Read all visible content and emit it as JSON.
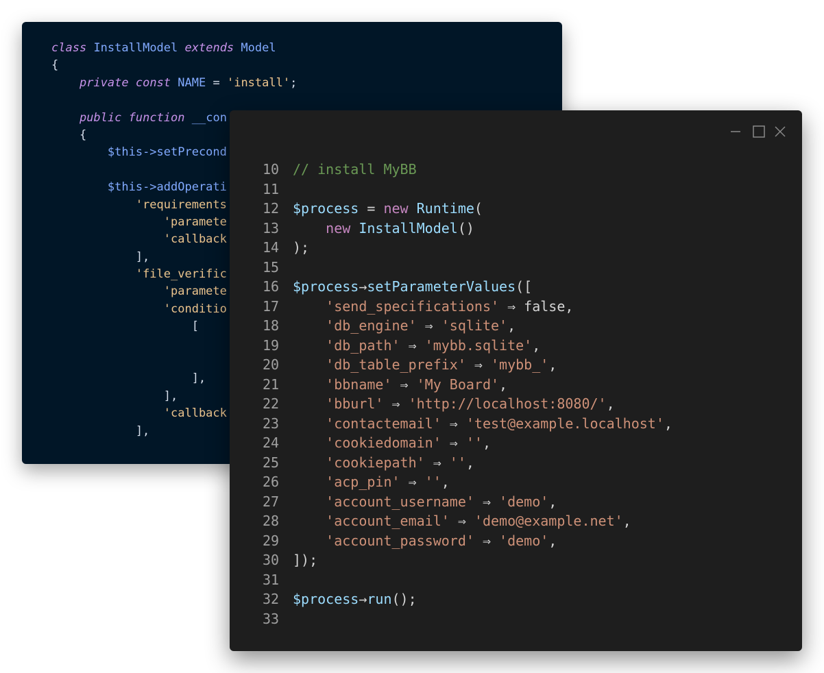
{
  "back_window": {
    "lines": [
      [
        {
          "t": "class",
          "c": "kw"
        },
        {
          "t": " "
        },
        {
          "t": "InstallModel",
          "c": "cls"
        },
        {
          "t": " "
        },
        {
          "t": "extends",
          "c": "kw"
        },
        {
          "t": " "
        },
        {
          "t": "Model",
          "c": "cls"
        }
      ],
      [
        {
          "t": "{"
        }
      ],
      [
        {
          "t": "    "
        },
        {
          "t": "private",
          "c": "kw"
        },
        {
          "t": " "
        },
        {
          "t": "const",
          "c": "kw"
        },
        {
          "t": " "
        },
        {
          "t": "NAME",
          "c": "cls"
        },
        {
          "t": " = "
        },
        {
          "t": "'install'",
          "c": "str"
        },
        {
          "t": ";"
        }
      ],
      [
        {
          "t": ""
        }
      ],
      [
        {
          "t": "    "
        },
        {
          "t": "public",
          "c": "kw"
        },
        {
          "t": " "
        },
        {
          "t": "function",
          "c": "kw"
        },
        {
          "t": " "
        },
        {
          "t": "__con",
          "c": "fn"
        }
      ],
      [
        {
          "t": "    {"
        }
      ],
      [
        {
          "t": "        "
        },
        {
          "t": "$this->setPrecond",
          "c": "var"
        }
      ],
      [
        {
          "t": ""
        }
      ],
      [
        {
          "t": "        "
        },
        {
          "t": "$this->addOperati",
          "c": "var"
        }
      ],
      [
        {
          "t": "            "
        },
        {
          "t": "'requirements",
          "c": "str"
        }
      ],
      [
        {
          "t": "                "
        },
        {
          "t": "'paramete",
          "c": "str"
        }
      ],
      [
        {
          "t": "                "
        },
        {
          "t": "'callback",
          "c": "str"
        }
      ],
      [
        {
          "t": "            ],"
        }
      ],
      [
        {
          "t": "            "
        },
        {
          "t": "'file_verific",
          "c": "str"
        }
      ],
      [
        {
          "t": "                "
        },
        {
          "t": "'paramete",
          "c": "str"
        }
      ],
      [
        {
          "t": "                "
        },
        {
          "t": "'conditio",
          "c": "str"
        }
      ],
      [
        {
          "t": "                    ["
        }
      ],
      [
        {
          "t": ""
        }
      ],
      [
        {
          "t": ""
        }
      ],
      [
        {
          "t": "                    ],"
        }
      ],
      [
        {
          "t": "                ],"
        }
      ],
      [
        {
          "t": "                "
        },
        {
          "t": "'callback",
          "c": "str"
        }
      ],
      [
        {
          "t": "            ],"
        }
      ]
    ]
  },
  "front_window": {
    "controls": [
      "minimize-icon",
      "maximize-icon",
      "close-icon"
    ],
    "lines": [
      {
        "n": "10",
        "tokens": [
          {
            "t": "// install MyBB",
            "c": "com"
          }
        ]
      },
      {
        "n": "11",
        "tokens": []
      },
      {
        "n": "12",
        "tokens": [
          {
            "t": "$process",
            "c": "var"
          },
          {
            "t": " = "
          },
          {
            "t": "new",
            "c": "kw"
          },
          {
            "t": " "
          },
          {
            "t": "Runtime",
            "c": "cls2"
          },
          {
            "t": "("
          }
        ]
      },
      {
        "n": "13",
        "tokens": [
          {
            "t": "    "
          },
          {
            "t": "new",
            "c": "kw"
          },
          {
            "t": " "
          },
          {
            "t": "InstallModel",
            "c": "cls2"
          },
          {
            "t": "()"
          }
        ]
      },
      {
        "n": "14",
        "tokens": [
          {
            "t": ");"
          }
        ]
      },
      {
        "n": "15",
        "tokens": []
      },
      {
        "n": "16",
        "tokens": [
          {
            "t": "$process",
            "c": "var"
          },
          {
            "t": "→"
          },
          {
            "t": "setParameterValues",
            "c": "cls2"
          },
          {
            "t": "(["
          }
        ]
      },
      {
        "n": "17",
        "tokens": [
          {
            "t": "    "
          },
          {
            "t": "'send_specifications'",
            "c": "str"
          },
          {
            "t": " ⇒ false,"
          }
        ]
      },
      {
        "n": "18",
        "tokens": [
          {
            "t": "    "
          },
          {
            "t": "'db_engine'",
            "c": "str"
          },
          {
            "t": " ⇒ "
          },
          {
            "t": "'sqlite'",
            "c": "str"
          },
          {
            "t": ","
          }
        ]
      },
      {
        "n": "19",
        "tokens": [
          {
            "t": "    "
          },
          {
            "t": "'db_path'",
            "c": "str"
          },
          {
            "t": " ⇒ "
          },
          {
            "t": "'mybb.sqlite'",
            "c": "str"
          },
          {
            "t": ","
          }
        ]
      },
      {
        "n": "20",
        "tokens": [
          {
            "t": "    "
          },
          {
            "t": "'db_table_prefix'",
            "c": "str"
          },
          {
            "t": " ⇒ "
          },
          {
            "t": "'mybb_'",
            "c": "str"
          },
          {
            "t": ","
          }
        ]
      },
      {
        "n": "21",
        "tokens": [
          {
            "t": "    "
          },
          {
            "t": "'bbname'",
            "c": "str"
          },
          {
            "t": " ⇒ "
          },
          {
            "t": "'My Board'",
            "c": "str"
          },
          {
            "t": ","
          }
        ]
      },
      {
        "n": "22",
        "tokens": [
          {
            "t": "    "
          },
          {
            "t": "'bburl'",
            "c": "str"
          },
          {
            "t": " ⇒ "
          },
          {
            "t": "'http://localhost:8080/'",
            "c": "str"
          },
          {
            "t": ","
          }
        ]
      },
      {
        "n": "23",
        "tokens": [
          {
            "t": "    "
          },
          {
            "t": "'contactemail'",
            "c": "str"
          },
          {
            "t": " ⇒ "
          },
          {
            "t": "'test@example.localhost'",
            "c": "str"
          },
          {
            "t": ","
          }
        ]
      },
      {
        "n": "24",
        "tokens": [
          {
            "t": "    "
          },
          {
            "t": "'cookiedomain'",
            "c": "str"
          },
          {
            "t": " ⇒ "
          },
          {
            "t": "''",
            "c": "str"
          },
          {
            "t": ","
          }
        ]
      },
      {
        "n": "25",
        "tokens": [
          {
            "t": "    "
          },
          {
            "t": "'cookiepath'",
            "c": "str"
          },
          {
            "t": " ⇒ "
          },
          {
            "t": "''",
            "c": "str"
          },
          {
            "t": ","
          }
        ]
      },
      {
        "n": "26",
        "tokens": [
          {
            "t": "    "
          },
          {
            "t": "'acp_pin'",
            "c": "str"
          },
          {
            "t": " ⇒ "
          },
          {
            "t": "''",
            "c": "str"
          },
          {
            "t": ","
          }
        ]
      },
      {
        "n": "27",
        "tokens": [
          {
            "t": "    "
          },
          {
            "t": "'account_username'",
            "c": "str"
          },
          {
            "t": " ⇒ "
          },
          {
            "t": "'demo'",
            "c": "str"
          },
          {
            "t": ","
          }
        ]
      },
      {
        "n": "28",
        "tokens": [
          {
            "t": "    "
          },
          {
            "t": "'account_email'",
            "c": "str"
          },
          {
            "t": " ⇒ "
          },
          {
            "t": "'demo@example.net'",
            "c": "str"
          },
          {
            "t": ","
          }
        ]
      },
      {
        "n": "29",
        "tokens": [
          {
            "t": "    "
          },
          {
            "t": "'account_password'",
            "c": "str"
          },
          {
            "t": " ⇒ "
          },
          {
            "t": "'demo'",
            "c": "str"
          },
          {
            "t": ","
          }
        ]
      },
      {
        "n": "30",
        "tokens": [
          {
            "t": "]);"
          }
        ]
      },
      {
        "n": "31",
        "tokens": []
      },
      {
        "n": "32",
        "tokens": [
          {
            "t": "$process",
            "c": "var"
          },
          {
            "t": "→"
          },
          {
            "t": "run",
            "c": "cls2"
          },
          {
            "t": "();"
          }
        ]
      },
      {
        "n": "33",
        "tokens": []
      }
    ]
  }
}
